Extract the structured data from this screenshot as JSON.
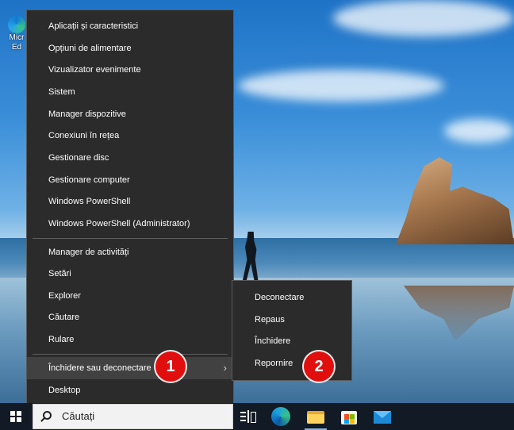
{
  "desktop": {
    "icons": [
      {
        "label_line1": "Micr",
        "label_line2": "Ed",
        "icon": "edge-icon"
      }
    ]
  },
  "context_menu": {
    "items": [
      {
        "label": "Aplicații și caracteristici"
      },
      {
        "label": "Opțiuni de alimentare"
      },
      {
        "label": "Vizualizator evenimente"
      },
      {
        "label": "Sistem"
      },
      {
        "label": "Manager dispozitive"
      },
      {
        "label": "Conexiuni în rețea"
      },
      {
        "label": "Gestionare disc"
      },
      {
        "label": "Gestionare computer"
      },
      {
        "label": "Windows PowerShell"
      },
      {
        "label": "Windows PowerShell (Administrator)"
      },
      {
        "label": "Manager de activități"
      },
      {
        "label": "Setări"
      },
      {
        "label": "Explorer"
      },
      {
        "label": "Căutare"
      },
      {
        "label": "Rulare"
      },
      {
        "label": "Închidere sau deconectare",
        "highlighted": true,
        "has_submenu": true
      },
      {
        "label": "Desktop"
      }
    ],
    "submenu_chevron": "›"
  },
  "submenu": {
    "items": [
      {
        "label": "Deconectare"
      },
      {
        "label": "Repaus"
      },
      {
        "label": "Închidere"
      },
      {
        "label": "Repornire"
      }
    ]
  },
  "callouts": [
    {
      "number": "1"
    },
    {
      "number": "2"
    }
  ],
  "taskbar": {
    "search_placeholder": "Căutați",
    "icons": [
      "windows-start-icon",
      "search-icon",
      "task-view-icon",
      "edge-icon",
      "file-explorer-icon",
      "store-icon",
      "mail-icon"
    ]
  },
  "colors": {
    "menu_bg": "#2b2b2b",
    "menu_highlight": "#414141",
    "callout_red": "#e10e0e",
    "taskbar_bg": "#121a26"
  }
}
